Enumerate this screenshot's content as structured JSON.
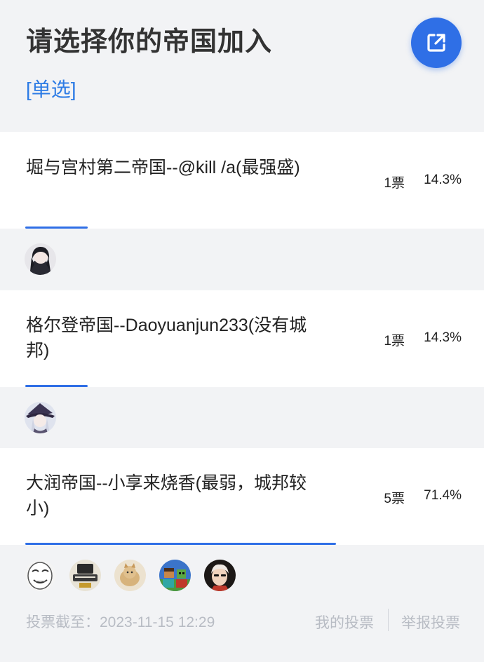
{
  "poll": {
    "title": "请选择你的帝国加入",
    "mode": "[单选]",
    "share_icon": "external-link-icon",
    "accent_color": "#2f6fe6"
  },
  "options": [
    {
      "text": "堀与宫村第二帝国--@kill /a(最强盛)",
      "votes": "1票",
      "percent": "14.3%",
      "share": 0.143,
      "voters": [
        "avatar-girl-dark-hair"
      ]
    },
    {
      "text": "格尔登帝国--Daoyuanjun233(没有城邦)",
      "votes": "1票",
      "percent": "14.3%",
      "share": 0.143,
      "voters": [
        "avatar-girl-witch-hat"
      ]
    },
    {
      "text": "大润帝国--小享来烧香(最弱，城邦较小)",
      "votes": "5票",
      "percent": "71.4%",
      "share": 0.714,
      "voters": [
        "avatar-meme-face",
        "avatar-badge-logo",
        "avatar-cat",
        "avatar-minecraft",
        "avatar-mozart"
      ]
    }
  ],
  "footer": {
    "deadline": "投票截至：2023-11-15 12:29",
    "my_votes": "我的投票",
    "report": "举报投票"
  }
}
